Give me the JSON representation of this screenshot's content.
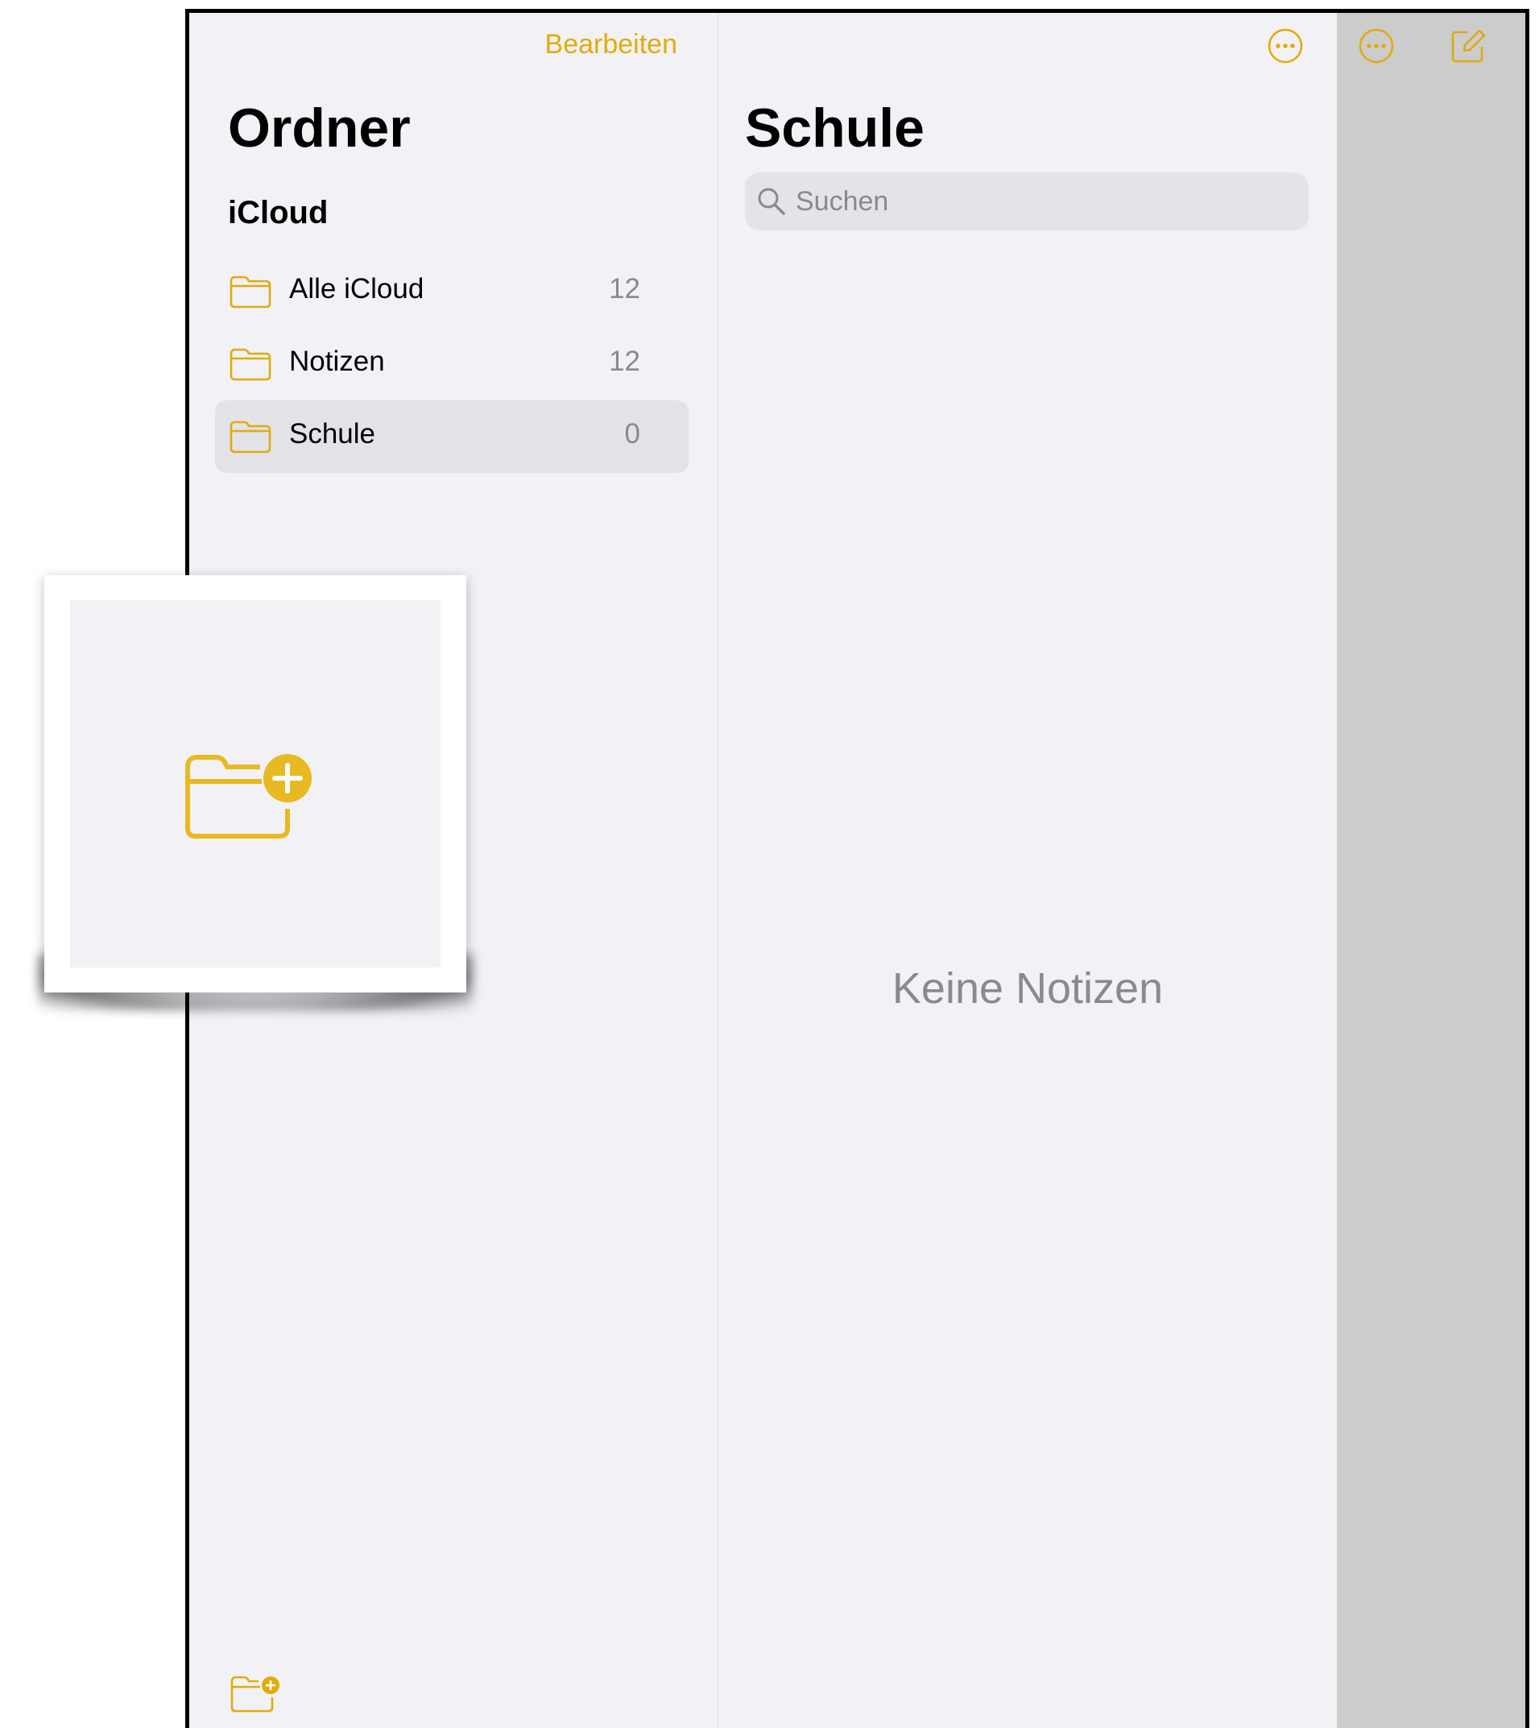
{
  "colors": {
    "accent": "#e0ac0b",
    "background": "#f2f1f6",
    "selected_row": "#e3e2e8",
    "secondary_text": "#8a8a8e",
    "detail_pane": "#cccccc"
  },
  "sidebar": {
    "edit_label": "Bearbeiten",
    "title": "Ordner",
    "section_title": "iCloud",
    "folders": [
      {
        "name": "Alle iCloud",
        "count": "12",
        "icon": "folder-icon",
        "selected": false
      },
      {
        "name": "Notizen",
        "count": "12",
        "icon": "folder-icon",
        "selected": false
      },
      {
        "name": "Schule",
        "count": "0",
        "icon": "folder-icon",
        "selected": true
      }
    ],
    "bottom_icon": "new-folder-icon"
  },
  "notelist": {
    "title": "Schule",
    "search_placeholder": "Suchen",
    "empty_text": "Keine Notizen",
    "more_icon": "ellipsis-circle-icon"
  },
  "detail": {
    "more_icon": "ellipsis-circle-icon",
    "compose_icon": "compose-icon"
  },
  "callout": {
    "icon": "new-folder-icon"
  }
}
